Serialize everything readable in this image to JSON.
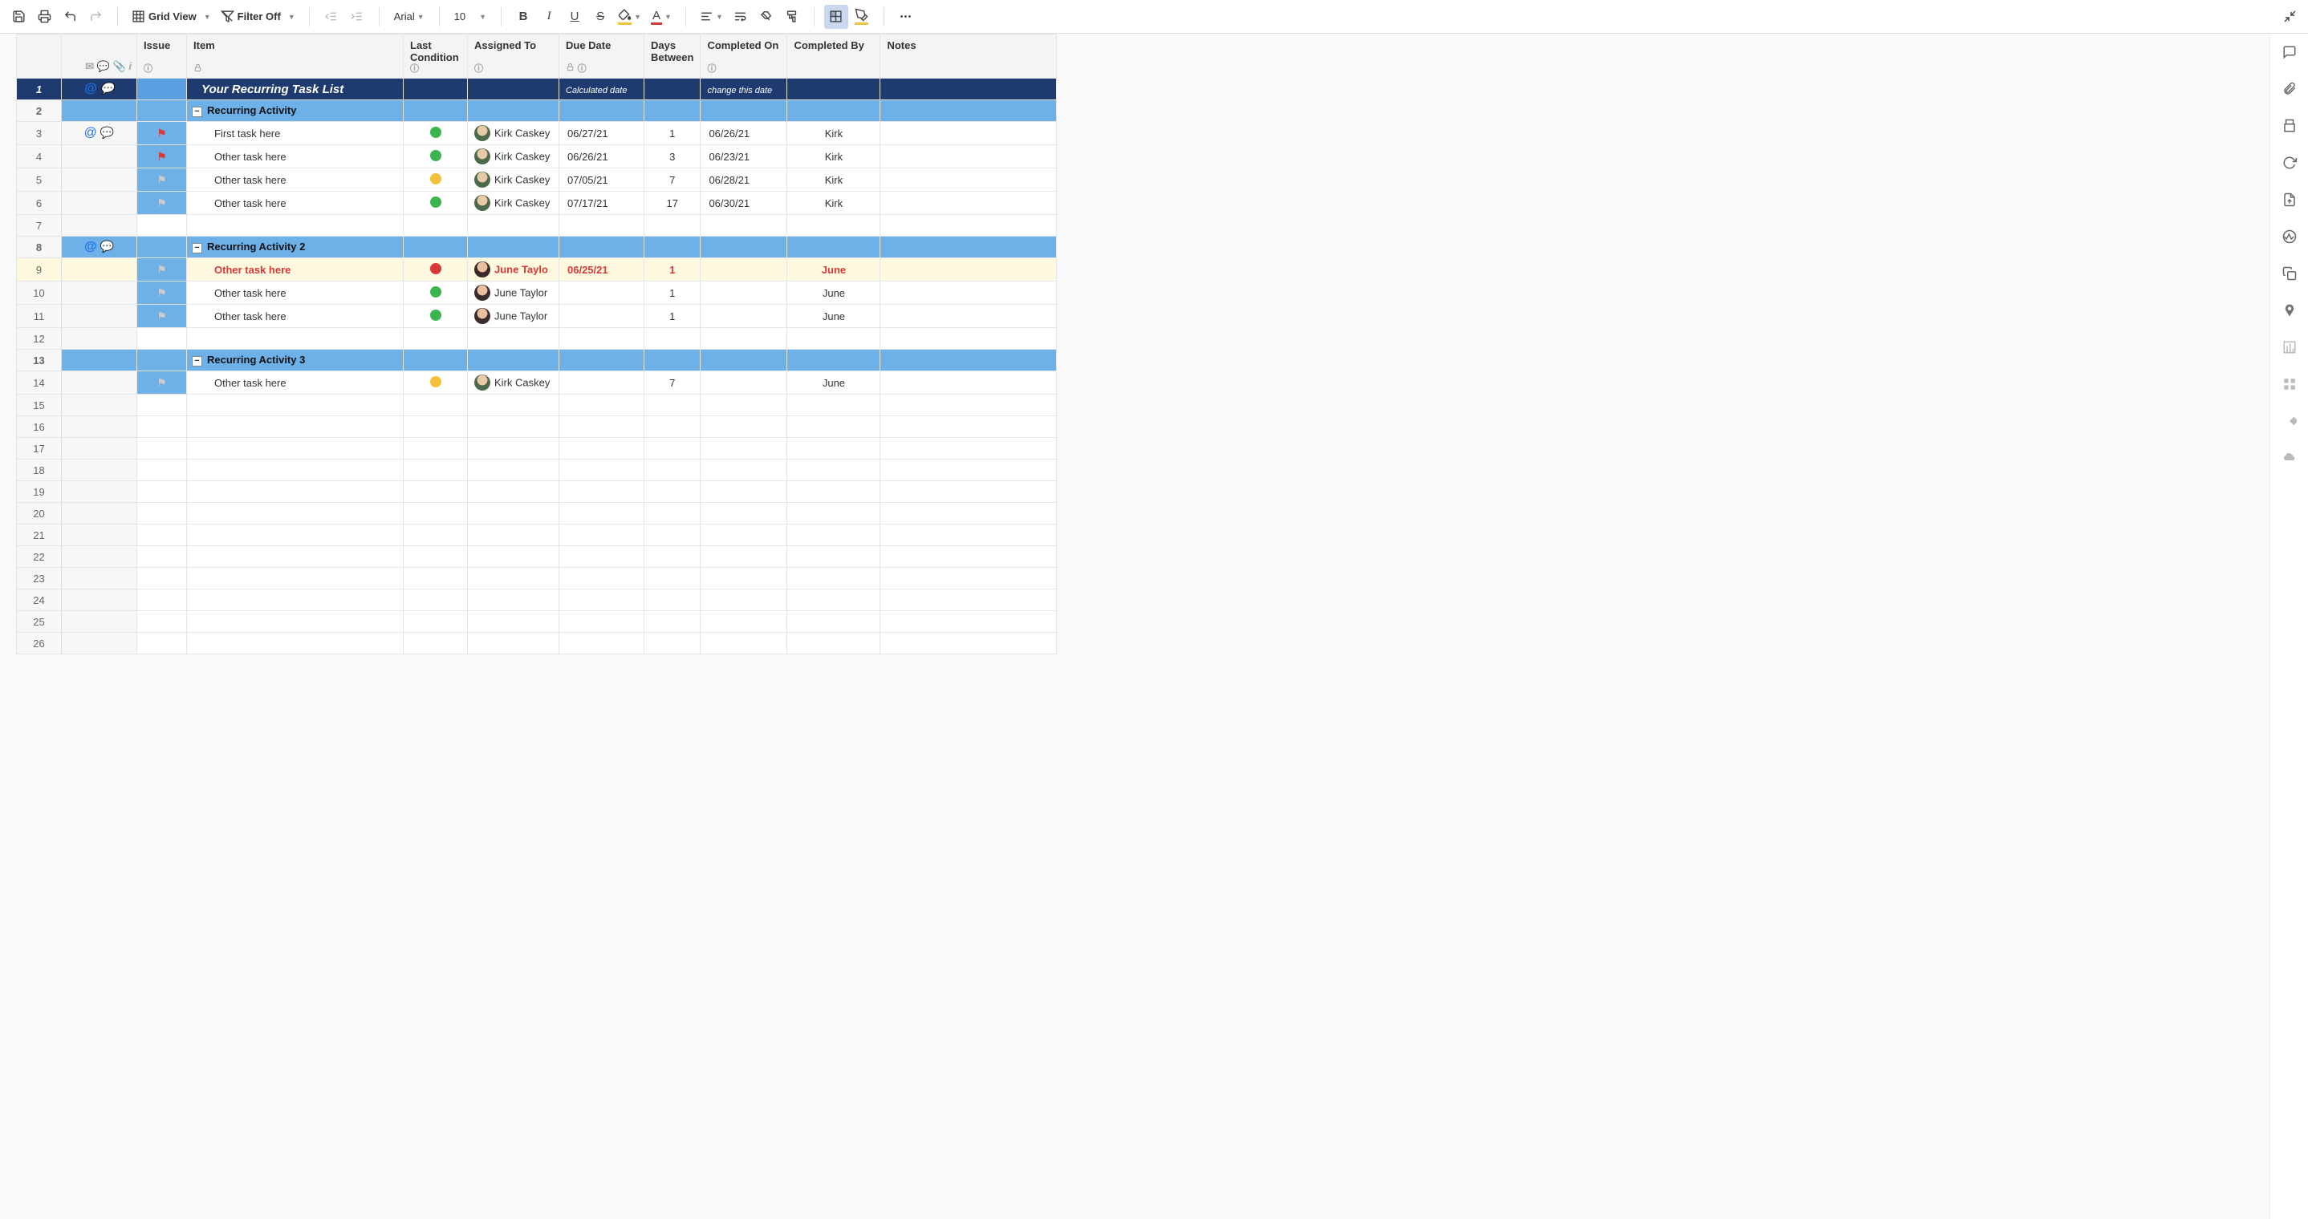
{
  "toolbar": {
    "view_label": "Grid View",
    "filter_label": "Filter Off",
    "font_family": "Arial",
    "font_size": "10"
  },
  "columns": {
    "issue": "Issue",
    "item": "Item",
    "last_condition": "Last Condition",
    "assigned_to": "Assigned To",
    "due_date": "Due Date",
    "days_between": "Days Between",
    "completed_on": "Completed On",
    "completed_by": "Completed By",
    "notes": "Notes"
  },
  "title_row": {
    "item": "Your Recurring Task List",
    "due_hint": "Calculated date",
    "compon_hint": "change this date"
  },
  "sections": [
    {
      "label": "Recurring Activity"
    },
    {
      "label": "Recurring Activity 2"
    },
    {
      "label": "Recurring Activity 3"
    }
  ],
  "rows": [
    {
      "num": 1,
      "type": "title"
    },
    {
      "num": 2,
      "type": "section",
      "section_idx": 0
    },
    {
      "num": 3,
      "type": "data",
      "attach": true,
      "comment": true,
      "flag": "red",
      "item": "First task here",
      "cond": "green",
      "assignee": "Kirk Caskey",
      "assignee_avatar": "kirk",
      "due": "06/27/21",
      "days": "1",
      "comp_on": "06/26/21",
      "comp_by": "Kirk"
    },
    {
      "num": 4,
      "type": "data",
      "flag": "red",
      "item": "Other task here",
      "cond": "green",
      "assignee": "Kirk Caskey",
      "assignee_avatar": "kirk",
      "due": "06/26/21",
      "days": "3",
      "comp_on": "06/23/21",
      "comp_by": "Kirk"
    },
    {
      "num": 5,
      "type": "data",
      "flag": "grey",
      "item": "Other task here",
      "cond": "yellow",
      "assignee": "Kirk Caskey",
      "assignee_avatar": "kirk",
      "due": "07/05/21",
      "days": "7",
      "comp_on": "06/28/21",
      "comp_by": "Kirk"
    },
    {
      "num": 6,
      "type": "data",
      "flag": "grey",
      "item": "Other task here",
      "cond": "green",
      "assignee": "Kirk Caskey",
      "assignee_avatar": "kirk",
      "due": "07/17/21",
      "days": "17",
      "comp_on": "06/30/21",
      "comp_by": "Kirk"
    },
    {
      "num": 7,
      "type": "empty"
    },
    {
      "num": 8,
      "type": "section",
      "section_idx": 1,
      "attach": true,
      "comment": true
    },
    {
      "num": 9,
      "type": "data",
      "highlight": true,
      "flag": "grey",
      "item": "Other task here",
      "cond": "red",
      "assignee": "June Taylo",
      "assignee_avatar": "june",
      "due": "06/25/21",
      "days": "1",
      "comp_on": "",
      "comp_by": "June"
    },
    {
      "num": 10,
      "type": "data",
      "flag": "grey",
      "item": "Other task here",
      "cond": "green",
      "assignee": "June Taylor",
      "assignee_avatar": "june",
      "due": "",
      "days": "1",
      "comp_on": "",
      "comp_by": "June"
    },
    {
      "num": 11,
      "type": "data",
      "flag": "grey",
      "item": "Other task here",
      "cond": "green",
      "assignee": "June Taylor",
      "assignee_avatar": "june",
      "due": "",
      "days": "1",
      "comp_on": "",
      "comp_by": "June"
    },
    {
      "num": 12,
      "type": "empty"
    },
    {
      "num": 13,
      "type": "section",
      "section_idx": 2
    },
    {
      "num": 14,
      "type": "data",
      "flag": "grey",
      "item": "Other task here",
      "cond": "yellow",
      "assignee": "Kirk Caskey",
      "assignee_avatar": "kirk",
      "due": "",
      "days": "7",
      "comp_on": "",
      "comp_by": "June"
    },
    {
      "num": 15,
      "type": "empty"
    },
    {
      "num": 16,
      "type": "empty"
    },
    {
      "num": 17,
      "type": "empty"
    },
    {
      "num": 18,
      "type": "empty"
    },
    {
      "num": 19,
      "type": "empty"
    },
    {
      "num": 20,
      "type": "empty"
    },
    {
      "num": 21,
      "type": "empty"
    },
    {
      "num": 22,
      "type": "empty"
    },
    {
      "num": 23,
      "type": "empty"
    },
    {
      "num": 24,
      "type": "empty"
    },
    {
      "num": 25,
      "type": "empty"
    },
    {
      "num": 26,
      "type": "empty"
    }
  ]
}
